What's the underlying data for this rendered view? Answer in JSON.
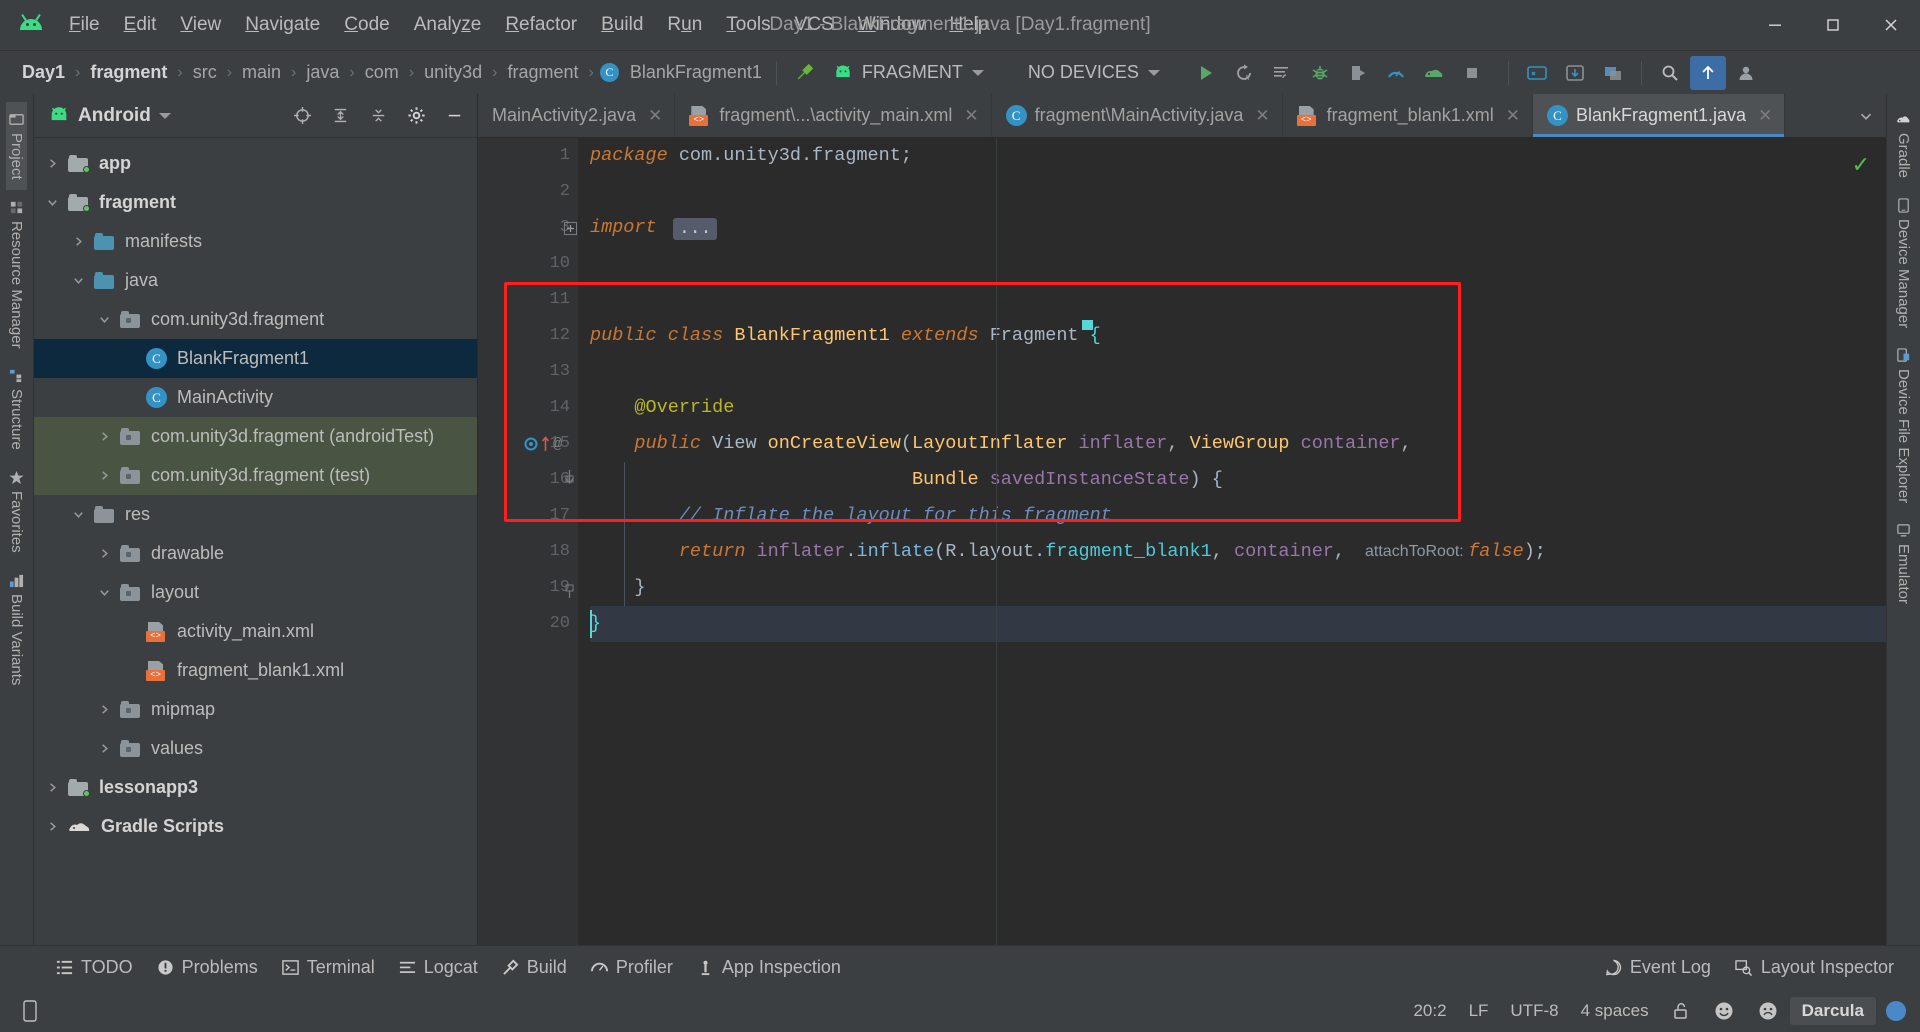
{
  "window": {
    "title": "Day1 - BlankFragment1.java [Day1.fragment]",
    "minimize": "–",
    "maximize": "❑",
    "close": "✕"
  },
  "menubar": {
    "items": [
      {
        "label": "File",
        "mnemonic": "F"
      },
      {
        "label": "Edit",
        "mnemonic": "E"
      },
      {
        "label": "View",
        "mnemonic": "V"
      },
      {
        "label": "Navigate",
        "mnemonic": "N"
      },
      {
        "label": "Code",
        "mnemonic": "C"
      },
      {
        "label": "Analyze",
        "mnemonic": "z"
      },
      {
        "label": "Refactor",
        "mnemonic": "R"
      },
      {
        "label": "Build",
        "mnemonic": "B"
      },
      {
        "label": "Run",
        "mnemonic": "u"
      },
      {
        "label": "Tools",
        "mnemonic": "T"
      },
      {
        "label": "VCS",
        "mnemonic": ""
      },
      {
        "label": "Window",
        "mnemonic": "W"
      },
      {
        "label": "Help",
        "mnemonic": "H"
      }
    ]
  },
  "breadcrumb": {
    "separator": "›",
    "items": [
      {
        "label": "Day1",
        "bold": true
      },
      {
        "label": "fragment",
        "bold": true
      },
      {
        "label": "src",
        "bold": false
      },
      {
        "label": "main",
        "bold": false
      },
      {
        "label": "java",
        "bold": false
      },
      {
        "label": "com",
        "bold": false
      },
      {
        "label": "unity3d",
        "bold": false
      },
      {
        "label": "fragment",
        "bold": false
      },
      {
        "label": "BlankFragment1",
        "bold": false,
        "icon": "class-icon",
        "icon_letter": "C"
      }
    ]
  },
  "toolbar": {
    "build_icon": "hammer-icon",
    "run_config": "FRAGMENT",
    "device_selector": "NO DEVICES",
    "buttons": [
      {
        "name": "run-button",
        "glyph": "▶"
      },
      {
        "name": "apply-changes-button",
        "glyph": "↻"
      },
      {
        "name": "apply-code-changes-button",
        "glyph": "≡"
      },
      {
        "name": "debug-button",
        "glyph": "🐞"
      },
      {
        "name": "attach-debugger-button",
        "glyph": "◗"
      },
      {
        "name": "profiler-button",
        "glyph": "◔"
      },
      {
        "name": "sync-project-button",
        "glyph": "🐘"
      },
      {
        "name": "stop-button",
        "glyph": "■"
      },
      {
        "name": "avd-manager-button",
        "glyph": "📱"
      },
      {
        "name": "sdk-manager-button",
        "glyph": "⬇"
      },
      {
        "name": "layout-inspector-button",
        "glyph": "⧉"
      },
      {
        "name": "search-everywhere-button",
        "glyph": "🔍"
      },
      {
        "name": "update-project-button",
        "glyph": "⬆"
      },
      {
        "name": "account-button",
        "glyph": "👤"
      }
    ]
  },
  "left_rail": {
    "items": [
      {
        "label": "Project",
        "icon": "project-icon",
        "active": true
      },
      {
        "label": "Resource Manager",
        "icon": "resource-icon",
        "active": false
      },
      {
        "label": "Structure",
        "icon": "structure-icon",
        "active": false
      },
      {
        "label": "Favorites",
        "icon": "star-icon",
        "active": false
      },
      {
        "label": "Build Variants",
        "icon": "variants-icon",
        "active": false
      }
    ]
  },
  "right_rail": {
    "items": [
      {
        "label": "Gradle",
        "icon": "gradle-icon"
      },
      {
        "label": "Device Manager",
        "icon": "device-manager-icon"
      },
      {
        "label": "Device File Explorer",
        "icon": "device-file-icon"
      },
      {
        "label": "Emulator",
        "icon": "emulator-icon"
      }
    ]
  },
  "project_panel": {
    "title": "Android",
    "dropdown_caret": "▾",
    "header_buttons": [
      {
        "name": "select-opened-file-button",
        "glyph": "⊕"
      },
      {
        "name": "expand-all-button",
        "glyph": "⇕"
      },
      {
        "name": "collapse-all-button",
        "glyph": "⇔"
      },
      {
        "name": "settings-gear-button",
        "glyph": "⚙"
      },
      {
        "name": "hide-panel-button",
        "glyph": "—"
      }
    ],
    "tree": [
      {
        "label": "app",
        "indent": 0,
        "arrow": "collapsed",
        "icon": "module-folder-icon",
        "bold": true,
        "state": "normal"
      },
      {
        "label": "fragment",
        "indent": 0,
        "arrow": "expanded",
        "icon": "module-folder-icon",
        "bold": true,
        "state": "normal"
      },
      {
        "label": "manifests",
        "indent": 1,
        "arrow": "collapsed",
        "icon": "blue-folder-icon",
        "bold": false,
        "state": "normal"
      },
      {
        "label": "java",
        "indent": 1,
        "arrow": "expanded",
        "icon": "blue-folder-icon",
        "bold": false,
        "state": "normal"
      },
      {
        "label": "com.unity3d.fragment",
        "indent": 2,
        "arrow": "expanded",
        "icon": "package-icon",
        "bold": false,
        "state": "normal"
      },
      {
        "label": "BlankFragment1",
        "indent": 3,
        "arrow": "none",
        "icon": "class-icon",
        "icon_letter": "C",
        "bold": false,
        "state": "selected"
      },
      {
        "label": "MainActivity",
        "indent": 3,
        "arrow": "none",
        "icon": "class-icon",
        "icon_letter": "C",
        "bold": false,
        "state": "normal"
      },
      {
        "label": "com.unity3d.fragment (androidTest)",
        "indent": 2,
        "arrow": "collapsed",
        "icon": "package-icon",
        "bold": false,
        "state": "test"
      },
      {
        "label": "com.unity3d.fragment (test)",
        "indent": 2,
        "arrow": "collapsed",
        "icon": "package-icon",
        "bold": false,
        "state": "test"
      },
      {
        "label": "res",
        "indent": 1,
        "arrow": "expanded",
        "icon": "res-folder-icon",
        "bold": false,
        "state": "normal"
      },
      {
        "label": "drawable",
        "indent": 2,
        "arrow": "collapsed",
        "icon": "package-icon",
        "bold": false,
        "state": "normal"
      },
      {
        "label": "layout",
        "indent": 2,
        "arrow": "expanded",
        "icon": "package-icon",
        "bold": false,
        "state": "normal"
      },
      {
        "label": "activity_main.xml",
        "indent": 3,
        "arrow": "none",
        "icon": "xml-file-icon",
        "bold": false,
        "state": "normal"
      },
      {
        "label": "fragment_blank1.xml",
        "indent": 3,
        "arrow": "none",
        "icon": "xml-file-icon",
        "bold": false,
        "state": "normal"
      },
      {
        "label": "mipmap",
        "indent": 2,
        "arrow": "collapsed",
        "icon": "package-icon",
        "bold": false,
        "state": "normal"
      },
      {
        "label": "values",
        "indent": 2,
        "arrow": "collapsed",
        "icon": "package-icon",
        "bold": false,
        "state": "normal"
      },
      {
        "label": "lessonapp3",
        "indent": 0,
        "arrow": "collapsed",
        "icon": "module-folder-icon",
        "bold": true,
        "state": "normal"
      },
      {
        "label": "Gradle Scripts",
        "indent": 0,
        "arrow": "collapsed",
        "icon": "gradle-icon",
        "bold": true,
        "state": "normal"
      }
    ]
  },
  "editor_tabs": {
    "tabs": [
      {
        "label": "MainActivity2.java",
        "icon": "none",
        "active": false,
        "closable": true
      },
      {
        "label": "fragment\\...\\activity_main.xml",
        "icon": "xml-file-icon",
        "active": false,
        "closable": true
      },
      {
        "label": "fragment\\MainActivity.java",
        "icon": "class-icon",
        "icon_letter": "C",
        "active": false,
        "closable": true
      },
      {
        "label": "fragment_blank1.xml",
        "icon": "xml-file-icon",
        "active": false,
        "closable": true
      },
      {
        "label": "BlankFragment1.java",
        "icon": "class-icon",
        "icon_letter": "C",
        "active": true,
        "closable": true
      }
    ],
    "close_glyph": "✕",
    "overflow_glyph": "⌄"
  },
  "code": {
    "inspection_status": "✓",
    "fold_placeholder": "...",
    "line_numbers": [
      "1",
      "2",
      "3",
      "10",
      "11",
      "12",
      "13",
      "14",
      "15",
      "16",
      "17",
      "18",
      "19",
      "20"
    ],
    "gutter_marks": {
      "line15": "◉↑ @"
    },
    "lines": [
      {
        "num": "1",
        "tokens": [
          {
            "t": "package ",
            "c": "kw"
          },
          {
            "t": "com.unity3d.fragment;",
            "c": "plain"
          }
        ]
      },
      {
        "num": "2",
        "tokens": []
      },
      {
        "num": "3",
        "tokens": [
          {
            "t": "import ",
            "c": "kw"
          }
        ]
      },
      {
        "num": "10",
        "tokens": []
      },
      {
        "num": "11",
        "tokens": []
      },
      {
        "num": "12",
        "tokens": [
          {
            "t": "public ",
            "c": "kw"
          },
          {
            "t": "class ",
            "c": "kw"
          },
          {
            "t": "BlankFragment1 ",
            "c": "cls2"
          },
          {
            "t": "extends ",
            "c": "kw"
          },
          {
            "t": "Fragment ",
            "c": "plain"
          },
          {
            "t": "{",
            "c": "brace"
          }
        ]
      },
      {
        "num": "13",
        "tokens": []
      },
      {
        "num": "14",
        "tokens": [
          {
            "t": "    @Override",
            "c": "anno"
          }
        ]
      },
      {
        "num": "15",
        "tokens": [
          {
            "t": "    ",
            "c": "plain"
          },
          {
            "t": "public ",
            "c": "kw"
          },
          {
            "t": "View ",
            "c": "plain"
          },
          {
            "t": "onCreateView",
            "c": "meth"
          },
          {
            "t": "(",
            "c": "plain"
          },
          {
            "t": "LayoutInflater ",
            "c": "cls2"
          },
          {
            "t": "inflater",
            "c": "purple"
          },
          {
            "t": ", ",
            "c": "plain"
          },
          {
            "t": "ViewGroup ",
            "c": "cls2"
          },
          {
            "t": "container",
            "c": "purple"
          },
          {
            "t": ",",
            "c": "plain"
          }
        ]
      },
      {
        "num": "16",
        "tokens": [
          {
            "t": "                             ",
            "c": "plain"
          },
          {
            "t": "Bundle ",
            "c": "cls2"
          },
          {
            "t": "savedInstanceState",
            "c": "purple"
          },
          {
            "t": ") {",
            "c": "plain"
          }
        ]
      },
      {
        "num": "17",
        "tokens": [
          {
            "t": "        // Inflate the layout for this fragment",
            "c": "cmt"
          }
        ]
      },
      {
        "num": "18",
        "tokens": [
          {
            "t": "        ",
            "c": "plain"
          },
          {
            "t": "return ",
            "c": "kw"
          },
          {
            "t": "inflater",
            "c": "purple"
          },
          {
            "t": ".",
            "c": "plain"
          },
          {
            "t": "inflate",
            "c": "meth-blue"
          },
          {
            "t": "(R.layout.",
            "c": "plain"
          },
          {
            "t": "fragment_blank1",
            "c": "teal"
          },
          {
            "t": ", ",
            "c": "plain"
          },
          {
            "t": "container",
            "c": "purple"
          },
          {
            "t": ", ",
            "c": "plain"
          },
          {
            "t": "  attachToRoot: ",
            "c": "hint"
          },
          {
            "t": "false",
            "c": "kw"
          },
          {
            "t": ");",
            "c": "plain"
          }
        ]
      },
      {
        "num": "19",
        "tokens": [
          {
            "t": "    }",
            "c": "plain"
          }
        ]
      },
      {
        "num": "20",
        "tokens": [
          {
            "t": "}",
            "c": "brace"
          }
        ]
      }
    ],
    "highlight_note": "red rectangle around lines 14-19"
  },
  "bottom_toolbar": {
    "items": [
      {
        "label": "TODO",
        "icon": "todo-icon"
      },
      {
        "label": "Problems",
        "icon": "problems-icon"
      },
      {
        "label": "Terminal",
        "icon": "terminal-icon"
      },
      {
        "label": "Logcat",
        "icon": "logcat-icon"
      },
      {
        "label": "Build",
        "icon": "hammer-icon"
      },
      {
        "label": "Profiler",
        "icon": "profiler-icon"
      },
      {
        "label": "App Inspection",
        "icon": "app-inspection-icon"
      }
    ],
    "right_items": [
      {
        "label": "Event Log",
        "icon": "event-log-icon"
      },
      {
        "label": "Layout Inspector",
        "icon": "layout-inspector-icon"
      }
    ]
  },
  "status_bar": {
    "caret_position": "20:2",
    "line_separator": "LF",
    "encoding": "UTF-8",
    "indent": "4 spaces",
    "lock_icon": "🔓",
    "smiley_icon": "☺",
    "frowny_icon": "☹",
    "theme": "Darcula",
    "left_icon": "device-preview-icon"
  }
}
